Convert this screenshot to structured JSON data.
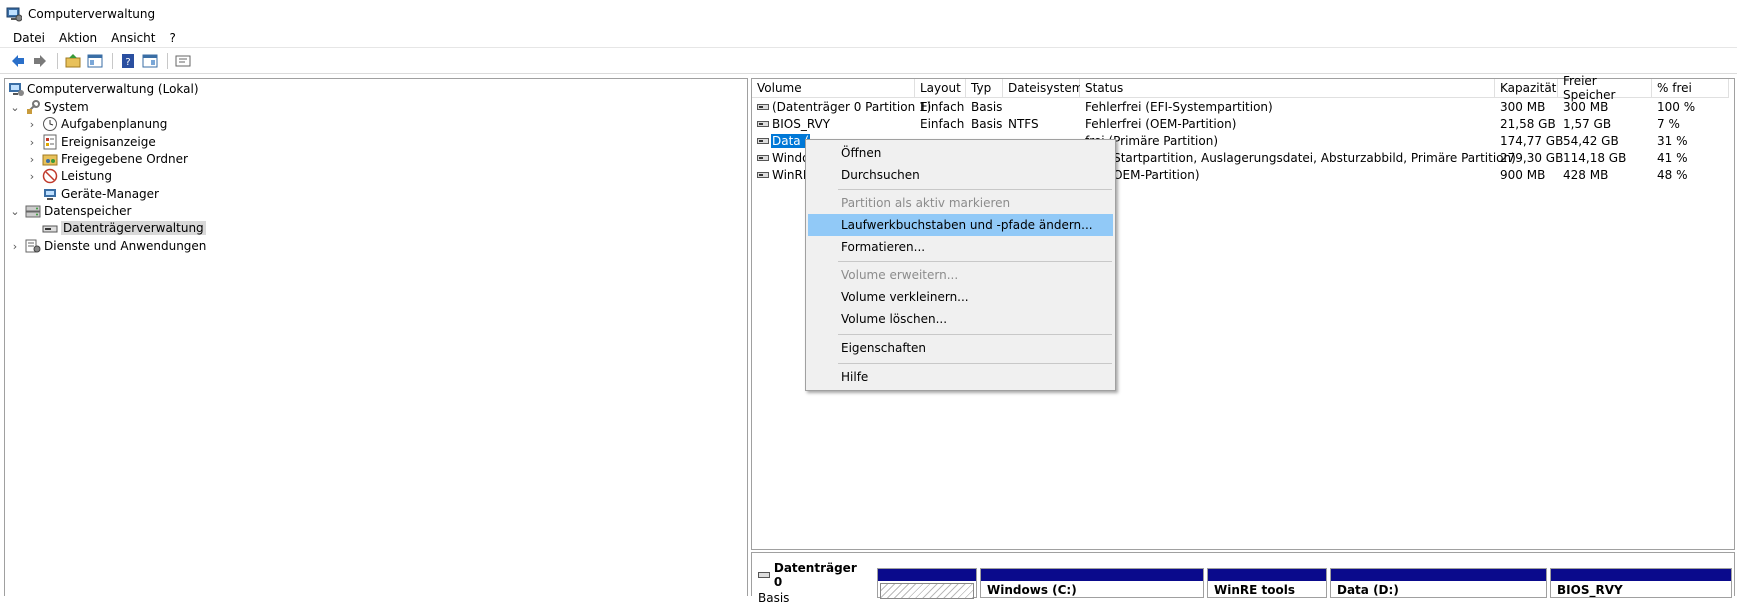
{
  "window": {
    "title": "Computerverwaltung"
  },
  "menu": [
    "Datei",
    "Aktion",
    "Ansicht",
    "?"
  ],
  "toolbar": [
    "back-icon",
    "forward-icon",
    "up-folder-icon",
    "show-hide-tree-icon",
    "help-icon",
    "show-hide-action-pane-icon",
    "properties-icon"
  ],
  "tree": {
    "root": "Computerverwaltung (Lokal)",
    "system": "System",
    "system_children": [
      "Aufgabenplanung",
      "Ereignisanzeige",
      "Freigegebene Ordner",
      "Leistung",
      "Geräte-Manager"
    ],
    "storage": "Datenspeicher",
    "storage_children": [
      "Datenträgerverwaltung"
    ],
    "services": "Dienste und Anwendungen"
  },
  "volume_table": {
    "headers": [
      "Volume",
      "Layout",
      "Typ",
      "Dateisystem",
      "Status",
      "Kapazität",
      "Freier Speicher",
      "% frei"
    ],
    "rows": [
      [
        "(Datenträger 0 Partition 1)",
        "Einfach",
        "Basis",
        "",
        "Fehlerfrei (EFI-Systempartition)",
        "300 MB",
        "300 MB",
        "100 %"
      ],
      [
        "BIOS_RVY",
        "Einfach",
        "Basis",
        "NTFS",
        "Fehlerfrei (OEM-Partition)",
        "21,58 GB",
        "1,57 GB",
        "7 %"
      ],
      [
        "Data (",
        "",
        "",
        "",
        "frei (Primäre Partition)",
        "174,77 GB",
        "54,42 GB",
        "31 %"
      ],
      [
        "Windo",
        "",
        "",
        "",
        "frei (Startpartition, Auslagerungsdatei, Absturzabbild, Primäre Partition)",
        "279,30 GB",
        "114,18 GB",
        "41 %"
      ],
      [
        "WinRE",
        "",
        "",
        "",
        "frei (OEM-Partition)",
        "900 MB",
        "428 MB",
        "48 %"
      ]
    ]
  },
  "disk": {
    "name": "Datenträger 0",
    "type": "Basis",
    "partitions": [
      "",
      "Windows (C:)",
      "WinRE tools",
      "Data (D:)",
      "BIOS_RVY"
    ]
  },
  "context_menu": {
    "items": [
      {
        "label": "Öffnen",
        "disabled": false
      },
      {
        "label": "Durchsuchen",
        "disabled": false
      },
      {
        "label": "Partition als aktiv markieren",
        "disabled": true
      },
      {
        "label": "Laufwerkbuchstaben und -pfade ändern...",
        "disabled": false,
        "highlighted": true
      },
      {
        "label": "Formatieren...",
        "disabled": false
      },
      {
        "label": "Volume erweitern...",
        "disabled": true
      },
      {
        "label": "Volume verkleinern...",
        "disabled": false
      },
      {
        "label": "Volume löschen...",
        "disabled": false
      },
      {
        "label": "Eigenschaften",
        "disabled": false
      },
      {
        "label": "Hilfe",
        "disabled": false
      }
    ]
  },
  "colors": {
    "selection": "#0078d7",
    "menu_highlight": "#91c9f7",
    "partition_bar": "#0a0a8c",
    "nav_arrow": "#2a6fc9"
  }
}
